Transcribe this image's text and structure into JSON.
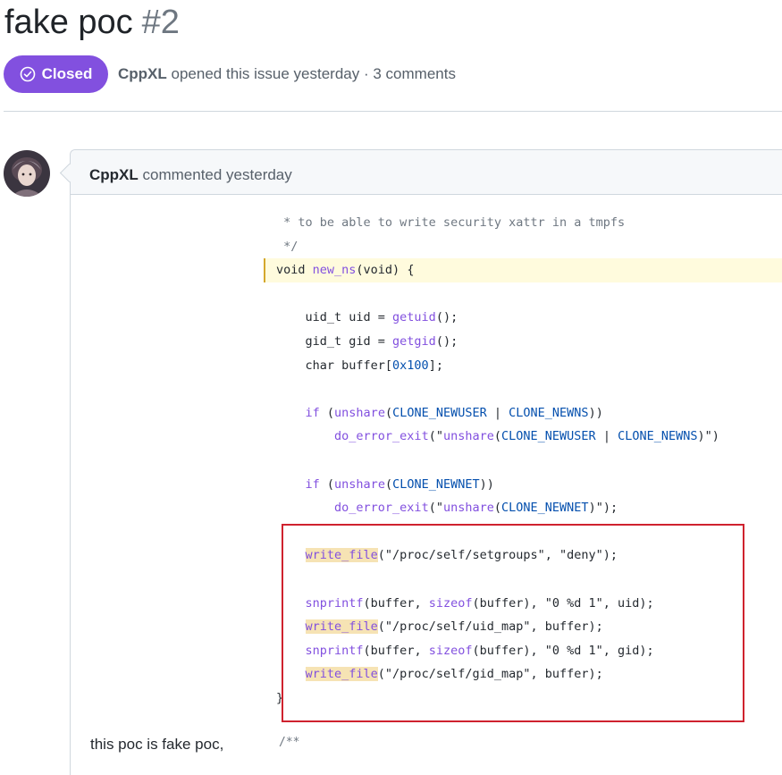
{
  "issue": {
    "title": "fake poc",
    "number": "#2",
    "state": "Closed",
    "author": "CppXL",
    "meta_text": "opened this issue yesterday · 3 comments"
  },
  "comment": {
    "author": "CppXL",
    "action": "commented yesterday",
    "body_text": "this poc is fake poc,",
    "code_lines": [
      " * to be able to write security xattr in a tmpfs",
      " */",
      "void new_ns(void) {",
      "",
      "    uid_t uid = getuid();",
      "    gid_t gid = getgid();",
      "    char buffer[0x100];",
      "",
      "    if (unshare(CLONE_NEWUSER | CLONE_NEWNS))",
      "        do_error_exit(\"unshare(CLONE_NEWUSER | CLONE_NEWNS)\")",
      "",
      "    if (unshare(CLONE_NEWNET))",
      "        do_error_exit(\"unshare(CLONE_NEWNET)\");",
      "",
      "    write_file(\"/proc/self/setgroups\", \"deny\");",
      "",
      "    snprintf(buffer, sizeof(buffer), \"0 %d 1\", uid);",
      "    write_file(\"/proc/self/uid_map\", buffer);",
      "    snprintf(buffer, sizeof(buffer), \"0 %d 1\", gid);",
      "    write_file(\"/proc/self/gid_map\", buffer);",
      "}"
    ],
    "trailing_code": "/**"
  },
  "icons": {
    "state": "check-circle-icon",
    "avatar": "user-avatar"
  },
  "colors": {
    "closed_badge": "#8250df",
    "highlight_box": "#cf222e",
    "code_highlight": "#f6e3b4"
  }
}
